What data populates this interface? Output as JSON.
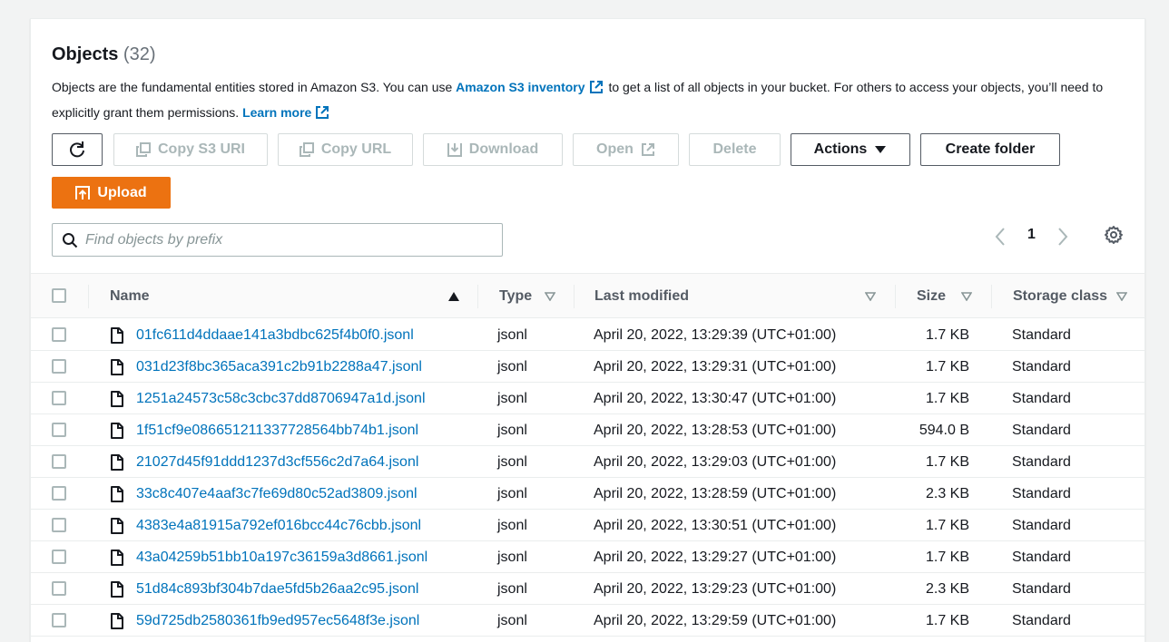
{
  "header": {
    "title": "Objects",
    "count": "(32)"
  },
  "description": {
    "part1": "Objects are the fundamental entities stored in Amazon S3. You can use",
    "inventory_link": "Amazon S3 inventory",
    "part2": "to get a list of all objects in your bucket. For others to access your objects, you’ll need to explicitly grant them permissions.",
    "learn_more": "Learn more"
  },
  "toolbar": {
    "copy_s3_uri": "Copy S3 URI",
    "copy_url": "Copy URL",
    "download": "Download",
    "open": "Open",
    "delete": "Delete",
    "actions": "Actions",
    "create_folder": "Create folder",
    "upload": "Upload"
  },
  "search": {
    "placeholder": "Find objects by prefix"
  },
  "pagination": {
    "current_page": "1"
  },
  "colors": {
    "link": "#0073bb",
    "primary": "#ec7211",
    "disabled": "#aab7b8"
  },
  "table": {
    "columns": {
      "name": "Name",
      "type": "Type",
      "last_modified": "Last modified",
      "size": "Size",
      "storage_class": "Storage class"
    },
    "rows": [
      {
        "name": "01fc611d4ddaae141a3bdbc625f4b0f0.jsonl",
        "type": "jsonl",
        "modified": "April 20, 2022, 13:29:39 (UTC+01:00)",
        "size": "1.7 KB",
        "storage": "Standard"
      },
      {
        "name": "031d23f8bc365aca391c2b91b2288a47.jsonl",
        "type": "jsonl",
        "modified": "April 20, 2022, 13:29:31 (UTC+01:00)",
        "size": "1.7 KB",
        "storage": "Standard"
      },
      {
        "name": "1251a24573c58c3cbc37dd8706947a1d.jsonl",
        "type": "jsonl",
        "modified": "April 20, 2022, 13:30:47 (UTC+01:00)",
        "size": "1.7 KB",
        "storage": "Standard"
      },
      {
        "name": "1f51cf9e086651211337728564bb74b1.jsonl",
        "type": "jsonl",
        "modified": "April 20, 2022, 13:28:53 (UTC+01:00)",
        "size": "594.0 B",
        "storage": "Standard"
      },
      {
        "name": "21027d45f91ddd1237d3cf556c2d7a64.jsonl",
        "type": "jsonl",
        "modified": "April 20, 2022, 13:29:03 (UTC+01:00)",
        "size": "1.7 KB",
        "storage": "Standard"
      },
      {
        "name": "33c8c407e4aaf3c7fe69d80c52ad3809.jsonl",
        "type": "jsonl",
        "modified": "April 20, 2022, 13:28:59 (UTC+01:00)",
        "size": "2.3 KB",
        "storage": "Standard"
      },
      {
        "name": "4383e4a81915a792ef016bcc44c76cbb.jsonl",
        "type": "jsonl",
        "modified": "April 20, 2022, 13:30:51 (UTC+01:00)",
        "size": "1.7 KB",
        "storage": "Standard"
      },
      {
        "name": "43a04259b51bb10a197c36159a3d8661.jsonl",
        "type": "jsonl",
        "modified": "April 20, 2022, 13:29:27 (UTC+01:00)",
        "size": "1.7 KB",
        "storage": "Standard"
      },
      {
        "name": "51d84c893bf304b7dae5fd5b26aa2c95.jsonl",
        "type": "jsonl",
        "modified": "April 20, 2022, 13:29:23 (UTC+01:00)",
        "size": "2.3 KB",
        "storage": "Standard"
      },
      {
        "name": "59d725db2580361fb9ed957ec5648f3e.jsonl",
        "type": "jsonl",
        "modified": "April 20, 2022, 13:29:59 (UTC+01:00)",
        "size": "1.7 KB",
        "storage": "Standard"
      }
    ]
  }
}
